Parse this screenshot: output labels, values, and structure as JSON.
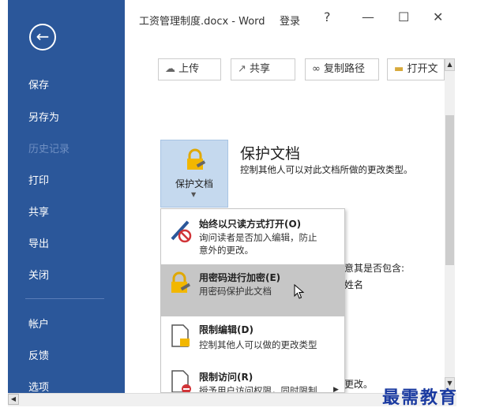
{
  "window": {
    "title": "工资管理制度.docx - Word",
    "login": "登录",
    "help": "?",
    "minimize": "—",
    "maximize": "☐",
    "close": "✕"
  },
  "sidebar": {
    "back_glyph": "←",
    "items": [
      {
        "label": "保存"
      },
      {
        "label": "另存为"
      },
      {
        "label": "历史记录"
      },
      {
        "label": "打印"
      },
      {
        "label": "共享"
      },
      {
        "label": "导出"
      },
      {
        "label": "关闭"
      },
      {
        "label": "帐户"
      },
      {
        "label": "反馈"
      },
      {
        "label": "选项"
      }
    ]
  },
  "toolbar": {
    "upload": "上传",
    "share": "共享",
    "copy_path": "复制路径",
    "open_location": "打开文"
  },
  "protect": {
    "tile_label": "保护文档",
    "heading": "保护文档",
    "description": "控制其他人可以对此文档所做的更改类型。"
  },
  "background_text": {
    "line1": "意其是否包含:",
    "line2": "姓名",
    "line3": "更改。"
  },
  "dropdown": {
    "items": [
      {
        "title": "始终以只读方式打开(O)",
        "desc1": "询问读者是否加入编辑，防止",
        "desc2": "意外的更改。"
      },
      {
        "title": "用密码进行加密(E)",
        "desc1": "用密码保护此文档",
        "desc2": ""
      },
      {
        "title": "限制编辑(D)",
        "desc1": "控制其他人可以做的更改类型",
        "desc2": ""
      },
      {
        "title": "限制访问(R)",
        "desc1": "授予用户访问权限，同时限制",
        "desc2": ""
      }
    ]
  },
  "watermark": "最需教育"
}
